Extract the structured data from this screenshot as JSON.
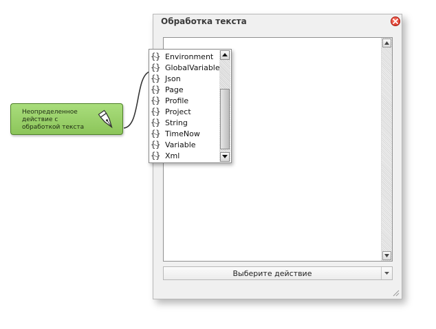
{
  "node": {
    "label": "Неопределенное действие с обработкой текста",
    "icon": "pen-nib-icon",
    "color": "#9fd56e"
  },
  "dialog": {
    "title": "Обработка текста",
    "close_icon": "close-icon",
    "action_combo": {
      "selected": "Выберите действие"
    }
  },
  "popup": {
    "items": [
      {
        "label": "Environment",
        "icon": "braces-icon"
      },
      {
        "label": "GlobalVariable",
        "icon": "braces-icon"
      },
      {
        "label": "Json",
        "icon": "braces-icon"
      },
      {
        "label": "Page",
        "icon": "braces-icon"
      },
      {
        "label": "Profile",
        "icon": "braces-icon"
      },
      {
        "label": "Project",
        "icon": "braces-icon"
      },
      {
        "label": "String",
        "icon": "braces-icon"
      },
      {
        "label": "TimeNow",
        "icon": "braces-icon"
      },
      {
        "label": "Variable",
        "icon": "braces-icon"
      },
      {
        "label": "Xml",
        "icon": "braces-icon"
      }
    ]
  }
}
